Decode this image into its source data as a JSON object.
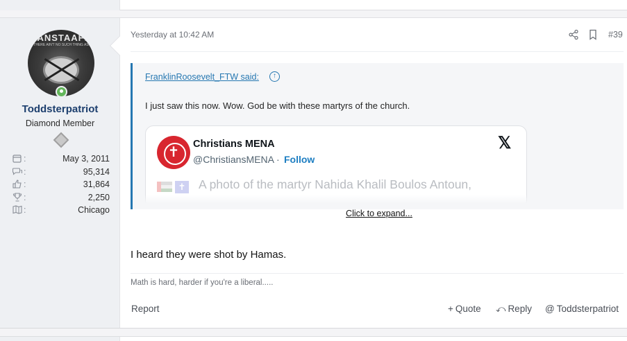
{
  "post": {
    "author": {
      "avatar_text": "TANSTAAFL",
      "avatar_subtext": "THERE AIN'T NO SUCH THING AS",
      "username": "Toddsterpatriot",
      "title": "Diamond Member",
      "stats": [
        {
          "icon": "calendar-icon",
          "value": "May 3, 2011"
        },
        {
          "icon": "messages-icon",
          "value": "95,314"
        },
        {
          "icon": "thumbs-up-icon",
          "value": "31,864"
        },
        {
          "icon": "trophy-icon",
          "value": "2,250"
        },
        {
          "icon": "location-icon",
          "value": "Chicago"
        }
      ]
    },
    "date": "Yesterday at 10:42 AM",
    "number": "#39",
    "quote": {
      "author_link": "FranklinRoosevelt_FTW said:",
      "text": "I just saw this now. Wow. God be with these martyrs of the church.",
      "embed": {
        "name": "Christians MENA",
        "handle": "@ChristiansMENA ·",
        "follow": "Follow",
        "preview": "A photo of the martyr Nahida Khalil Boulos Antoun,"
      },
      "expand": "Click to expand..."
    },
    "body": "I heard they were shot by Hamas.",
    "signature": "Math is hard, harder if you're a liberal.....",
    "actions": {
      "report": "Report",
      "quote": "Quote",
      "reply": "Reply",
      "mention": "Toddsterpatriot"
    }
  },
  "colors": {
    "link": "#2577b1",
    "username": "#1d3f6e",
    "online": "#63b65b",
    "follow": "#1d7ec2"
  }
}
